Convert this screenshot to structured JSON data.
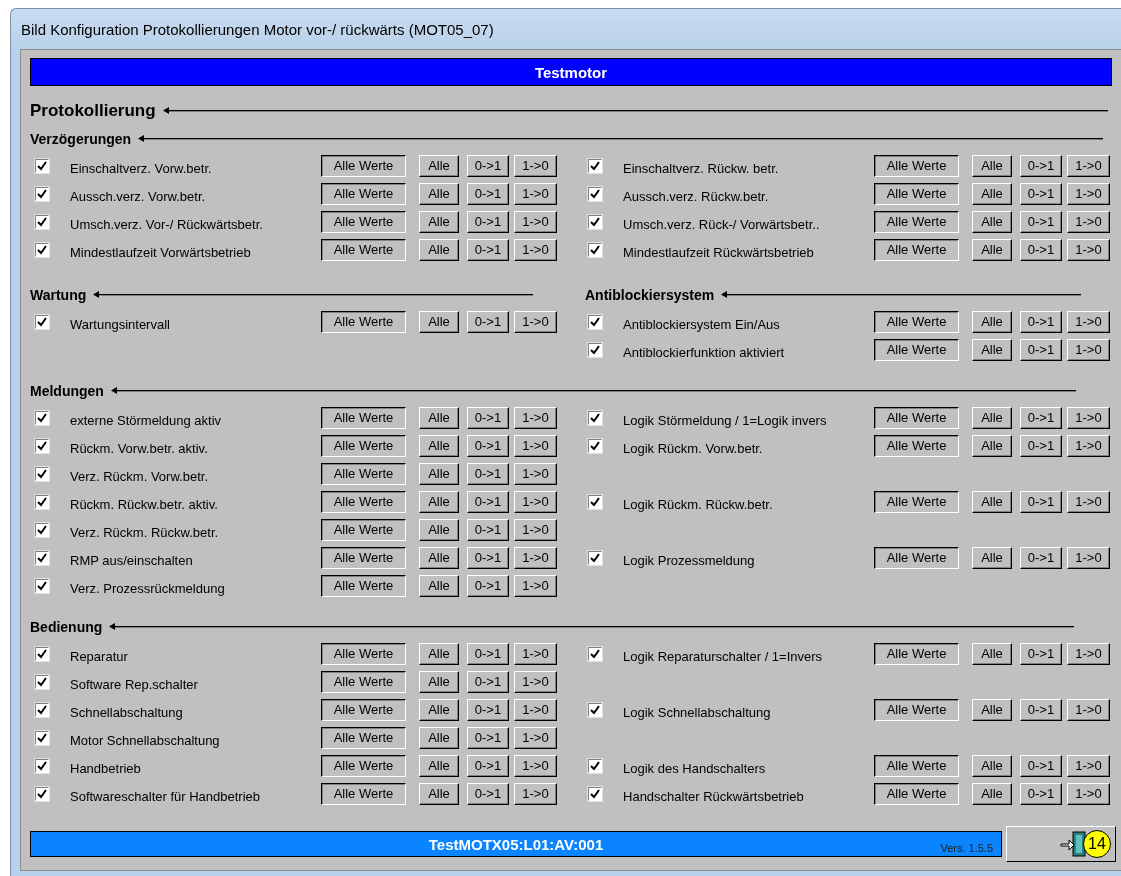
{
  "window": {
    "title": "Bild Konfiguration Protokollierungen Motor vor-/ rückwärts (MOT05_07)"
  },
  "header": {
    "title": "Testmotor"
  },
  "main_heading": "Protokollierung",
  "blocks": [
    {
      "heading": "Verzögerungen",
      "rows": [
        {
          "left": {
            "label": "Einschaltverz. Vorw.betr.",
            "checked": true,
            "buttons": [
              "Alle Werte",
              "Alle",
              "0->1",
              "1->0"
            ]
          },
          "right": {
            "label": "Einschaltverz. Rückw. betr.",
            "checked": true,
            "buttons": [
              "Alle Werte",
              "Alle",
              "0->1",
              "1->0"
            ]
          }
        },
        {
          "left": {
            "label": "Aussch.verz. Vorw.betr.",
            "checked": true,
            "buttons": [
              "Alle Werte",
              "Alle",
              "0->1",
              "1->0"
            ]
          },
          "right": {
            "label": "Aussch.verz. Rückw.betr.",
            "checked": true,
            "buttons": [
              "Alle Werte",
              "Alle",
              "0->1",
              "1->0"
            ]
          }
        },
        {
          "left": {
            "label": "Umsch.verz. Vor-/ Rückwärtsbetr.",
            "checked": true,
            "buttons": [
              "Alle Werte",
              "Alle",
              "0->1",
              "1->0"
            ]
          },
          "right": {
            "label": "Umsch.verz. Rück-/ Vorwärtsbetr..",
            "checked": true,
            "buttons": [
              "Alle Werte",
              "Alle",
              "0->1",
              "1->0"
            ]
          }
        },
        {
          "left": {
            "label": "Mindestlaufzeit Vorwärtsbetrieb",
            "checked": true,
            "buttons": [
              "Alle Werte",
              "Alle",
              "0->1",
              "1->0"
            ]
          },
          "right": {
            "label": "Mindestlaufzeit Rückwärtsbetrieb",
            "checked": true,
            "buttons": [
              "Alle Werte",
              "Alle",
              "0->1",
              "1->0"
            ]
          }
        }
      ]
    },
    {
      "heading": "Wartung",
      "heading_right": "Antiblockiersystem",
      "rows": [
        {
          "left": {
            "label": "Wartungsintervall",
            "checked": true,
            "buttons": [
              "Alle Werte",
              "Alle",
              "0->1",
              "1->0"
            ]
          },
          "right": {
            "label": "Antiblockiersystem Ein/Aus",
            "checked": true,
            "buttons": [
              "Alle Werte",
              "Alle",
              "0->1",
              "1->0"
            ]
          }
        },
        {
          "right": {
            "label": "Antiblockierfunktion aktiviert",
            "checked": true,
            "buttons": [
              "Alle Werte",
              "Alle",
              "0->1",
              "1->0"
            ]
          }
        }
      ]
    },
    {
      "heading": "Meldungen",
      "rows": [
        {
          "left": {
            "label": "externe Störmeldung aktiv",
            "checked": true,
            "buttons": [
              "Alle Werte",
              "Alle",
              "0->1",
              "1->0"
            ]
          },
          "right": {
            "label": "Logik Störmeldung / 1=Logik invers",
            "checked": true,
            "buttons": [
              "Alle Werte",
              "Alle",
              "0->1",
              "1->0"
            ]
          }
        },
        {
          "left": {
            "label": "Rückm. Vorw.betr. aktiv.",
            "checked": true,
            "buttons": [
              "Alle Werte",
              "Alle",
              "0->1",
              "1->0"
            ]
          },
          "right": {
            "label": "Logik Rückm. Vorw.betr.",
            "checked": true,
            "buttons": [
              "Alle Werte",
              "Alle",
              "0->1",
              "1->0"
            ]
          }
        },
        {
          "left": {
            "label": "Verz. Rückm. Vorw.betr.",
            "checked": true,
            "buttons": [
              "Alle Werte",
              "Alle",
              "0->1",
              "1->0"
            ]
          }
        },
        {
          "left": {
            "label": "Rückm. Rückw.betr. aktiv.",
            "checked": true,
            "buttons": [
              "Alle Werte",
              "Alle",
              "0->1",
              "1->0"
            ]
          },
          "right": {
            "label": "Logik Rückm. Rückw.betr.",
            "checked": true,
            "buttons": [
              "Alle Werte",
              "Alle",
              "0->1",
              "1->0"
            ]
          }
        },
        {
          "left": {
            "label": "Verz. Rückm. Rückw.betr.",
            "checked": true,
            "buttons": [
              "Alle Werte",
              "Alle",
              "0->1",
              "1->0"
            ]
          }
        },
        {
          "left": {
            "label": "RMP aus/einschalten",
            "checked": true,
            "buttons": [
              "Alle Werte",
              "Alle",
              "0->1",
              "1->0"
            ]
          },
          "right": {
            "label": "Logik Prozessmeldung",
            "checked": true,
            "buttons": [
              "Alle Werte",
              "Alle",
              "0->1",
              "1->0"
            ]
          }
        },
        {
          "left": {
            "label": "Verz. Prozessrückmeldung",
            "checked": true,
            "buttons": [
              "Alle Werte",
              "Alle",
              "0->1",
              "1->0"
            ]
          }
        }
      ]
    },
    {
      "heading": "Bedienung",
      "rows": [
        {
          "left": {
            "label": "Reparatur",
            "checked": true,
            "buttons": [
              "Alle Werte",
              "Alle",
              "0->1",
              "1->0"
            ]
          },
          "right": {
            "label": "Logik Reparaturschalter / 1=Invers",
            "checked": true,
            "buttons": [
              "Alle Werte",
              "Alle",
              "0->1",
              "1->0"
            ]
          }
        },
        {
          "left": {
            "label": "Software Rep.schalter",
            "checked": true,
            "buttons": [
              "Alle Werte",
              "Alle",
              "0->1",
              "1->0"
            ]
          }
        },
        {
          "left": {
            "label": "Schnellabschaltung",
            "checked": true,
            "buttons": [
              "Alle Werte",
              "Alle",
              "0->1",
              "1->0"
            ]
          },
          "right": {
            "label": "Logik Schnellabschaltung",
            "checked": true,
            "buttons": [
              "Alle Werte",
              "Alle",
              "0->1",
              "1->0"
            ]
          }
        },
        {
          "left": {
            "label": "Motor Schnellabschaltung",
            "checked": true,
            "buttons": [
              "Alle Werte",
              "Alle",
              "0->1",
              "1->0"
            ]
          }
        },
        {
          "left": {
            "label": "Handbetrieb",
            "checked": true,
            "buttons": [
              "Alle Werte",
              "Alle",
              "0->1",
              "1->0"
            ]
          },
          "right": {
            "label": "Logik des Handschalters",
            "checked": true,
            "buttons": [
              "Alle Werte",
              "Alle",
              "0->1",
              "1->0"
            ]
          }
        },
        {
          "left": {
            "label": "Softwareschalter für Handbetrieb",
            "checked": true,
            "buttons": [
              "Alle Werte",
              "Alle",
              "0->1",
              "1->0"
            ]
          },
          "right": {
            "label": "Handschalter Rückwärtsbetrieb",
            "checked": true,
            "buttons": [
              "Alle Werte",
              "Alle",
              "0->1",
              "1->0"
            ]
          }
        }
      ]
    }
  ],
  "status_bar": {
    "address": "TestMOTX05:L01:AV:001",
    "version": "Vers. 1.5.5"
  },
  "exit_button": {
    "badge": "14"
  }
}
